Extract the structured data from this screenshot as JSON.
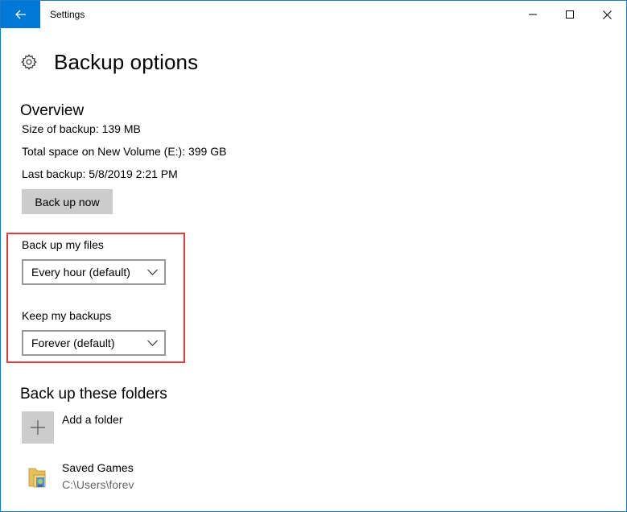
{
  "window": {
    "title": "Settings"
  },
  "header": {
    "title": "Backup options"
  },
  "overview": {
    "title": "Overview",
    "size_line": "Size of backup: 139 MB",
    "space_line": "Total space on New Volume (E:): 399 GB",
    "last_backup_line": "Last backup: 5/8/2019 2:21 PM",
    "backup_now_label": "Back up now"
  },
  "frequency": {
    "label": "Back up my files",
    "selected": "Every hour (default)"
  },
  "retention": {
    "label": "Keep my backups",
    "selected": "Forever (default)"
  },
  "folders": {
    "title": "Back up these folders",
    "add_label": "Add a folder",
    "items": [
      {
        "name": "Saved Games",
        "path": "C:\\Users\\forev",
        "icon": "saved-games-folder-icon"
      }
    ]
  },
  "colors": {
    "accent": "#0078d7",
    "highlight_border": "#e03c3c",
    "button_gray": "#cccccc"
  }
}
